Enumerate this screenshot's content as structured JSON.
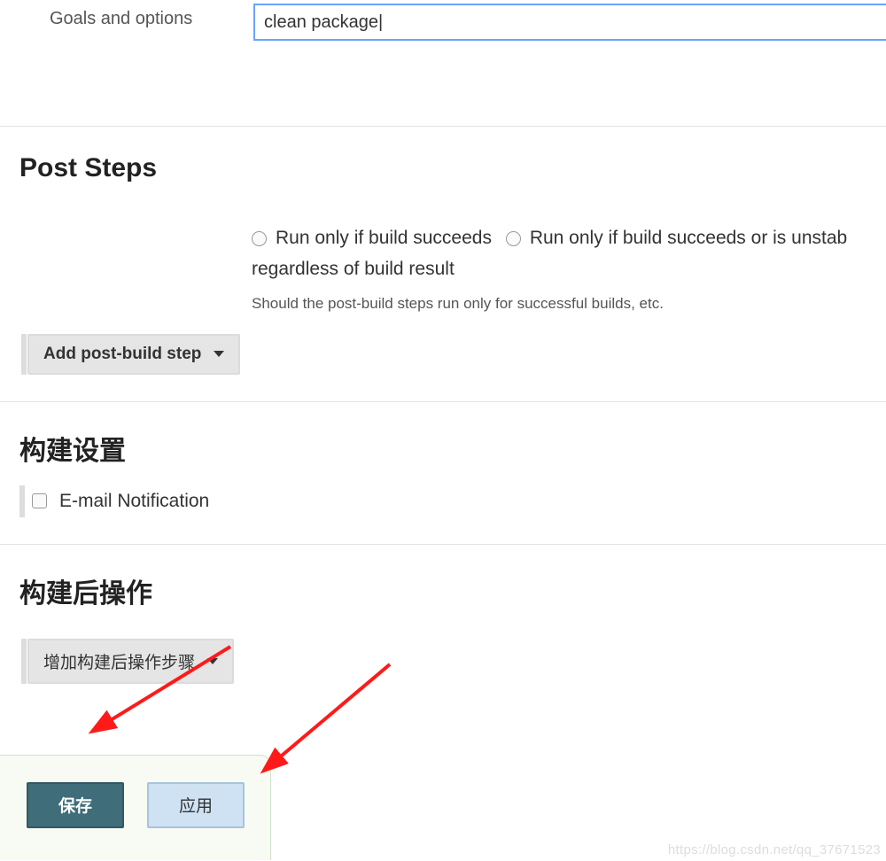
{
  "goals": {
    "label": "Goals and options",
    "value": "clean package|"
  },
  "post_steps": {
    "heading": "Post Steps",
    "radio1": "Run only if build succeeds",
    "radio2": "Run only if build succeeds or is unstab",
    "radio_line2": "regardless of build result",
    "help": "Should the post-build steps run only for successful builds, etc.",
    "add_btn": "Add post-build step"
  },
  "build_settings": {
    "heading": "构建设置",
    "email_label": "E-mail Notification"
  },
  "post_build": {
    "heading": "构建后操作",
    "add_btn": "增加构建后操作步骤"
  },
  "actions": {
    "save": "保存",
    "apply": "应用"
  },
  "watermark": "https://blog.csdn.net/qq_37671523"
}
